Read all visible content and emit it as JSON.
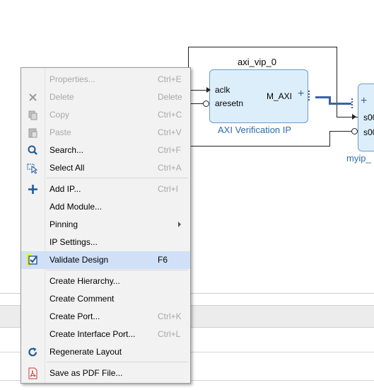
{
  "diagram": {
    "block_instance": "axi_vip_0",
    "ports": {
      "aclk": "aclk",
      "aresetn": "aresetn",
      "m_axi": "M_AXI"
    },
    "block_label": "AXI Verification IP",
    "second_block_label": "myip_",
    "second_ports": [
      "s00",
      "s00"
    ],
    "colors": {
      "block_fill": "#ddeefb",
      "block_border": "#6a9cc7",
      "bus": "#3a62a6",
      "label": "#2e6ca8"
    }
  },
  "context_menu": {
    "items": [
      {
        "label": "Properties...",
        "shortcut": "Ctrl+E",
        "icon": "",
        "disabled": true
      },
      {
        "label": "Delete",
        "shortcut": "Delete",
        "icon": "close-icon",
        "disabled": true
      },
      {
        "label": "Copy",
        "shortcut": "Ctrl+C",
        "icon": "copy-icon",
        "disabled": true
      },
      {
        "label": "Paste",
        "shortcut": "Ctrl+V",
        "icon": "paste-icon",
        "disabled": true
      },
      {
        "label": "Search...",
        "shortcut": "Ctrl+F",
        "icon": "search-icon",
        "disabled": false
      },
      {
        "label": "Select All",
        "shortcut": "Ctrl+A",
        "icon": "select-all-icon",
        "disabled": false
      },
      {
        "label": "Add IP...",
        "shortcut": "Ctrl+I",
        "icon": "plus-icon",
        "disabled": false
      },
      {
        "label": "Add Module...",
        "shortcut": "",
        "icon": "",
        "disabled": false
      },
      {
        "label": "Pinning",
        "shortcut": "",
        "icon": "",
        "disabled": false,
        "submenu": true
      },
      {
        "label": "IP Settings...",
        "shortcut": "",
        "icon": "",
        "disabled": false
      },
      {
        "label": "Validate Design",
        "shortcut": "F6",
        "icon": "validate-checkbox-icon",
        "disabled": false,
        "highlighted": true
      },
      {
        "label": "Create Hierarchy...",
        "shortcut": "",
        "icon": "",
        "disabled": false
      },
      {
        "label": "Create Comment",
        "shortcut": "",
        "icon": "",
        "disabled": false
      },
      {
        "label": "Create Port...",
        "shortcut": "Ctrl+K",
        "icon": "",
        "disabled": false
      },
      {
        "label": "Create Interface Port...",
        "shortcut": "Ctrl+L",
        "icon": "",
        "disabled": false
      },
      {
        "label": "Regenerate Layout",
        "shortcut": "",
        "icon": "refresh-icon",
        "disabled": false
      },
      {
        "label": "Save as PDF File...",
        "shortcut": "",
        "icon": "pdf-icon",
        "disabled": false
      }
    ]
  }
}
